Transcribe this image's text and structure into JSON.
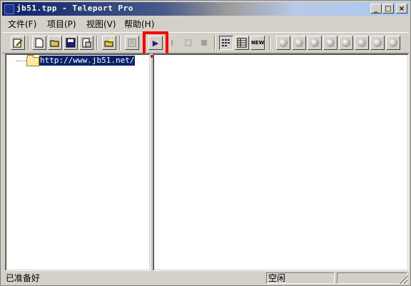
{
  "window": {
    "title": "jb51.tpp - Teleport Pro"
  },
  "caption_buttons": {
    "minimize": "_",
    "maximize": "□",
    "close": "×"
  },
  "menu": [
    {
      "label": "文件(F)"
    },
    {
      "label": "项目(P)"
    },
    {
      "label": "视图(V)"
    },
    {
      "label": "帮助(H)"
    }
  ],
  "toolbar": {
    "icons": [
      "edit-icon",
      "new-icon",
      "open-icon",
      "save-icon",
      "properties-icon",
      "new-project-wizard-icon",
      "view-icon",
      "start-icon",
      "pause-icon",
      "stop-icon",
      "stop-all-icon",
      "list-view-icon",
      "detail-view-icon",
      "new-icon-badge"
    ],
    "start_glyph": "▶",
    "new_badge": "NEW"
  },
  "tree": {
    "root_label": "http://www.jb51.net/"
  },
  "status": {
    "left": "已准备好",
    "state": "空闲"
  }
}
